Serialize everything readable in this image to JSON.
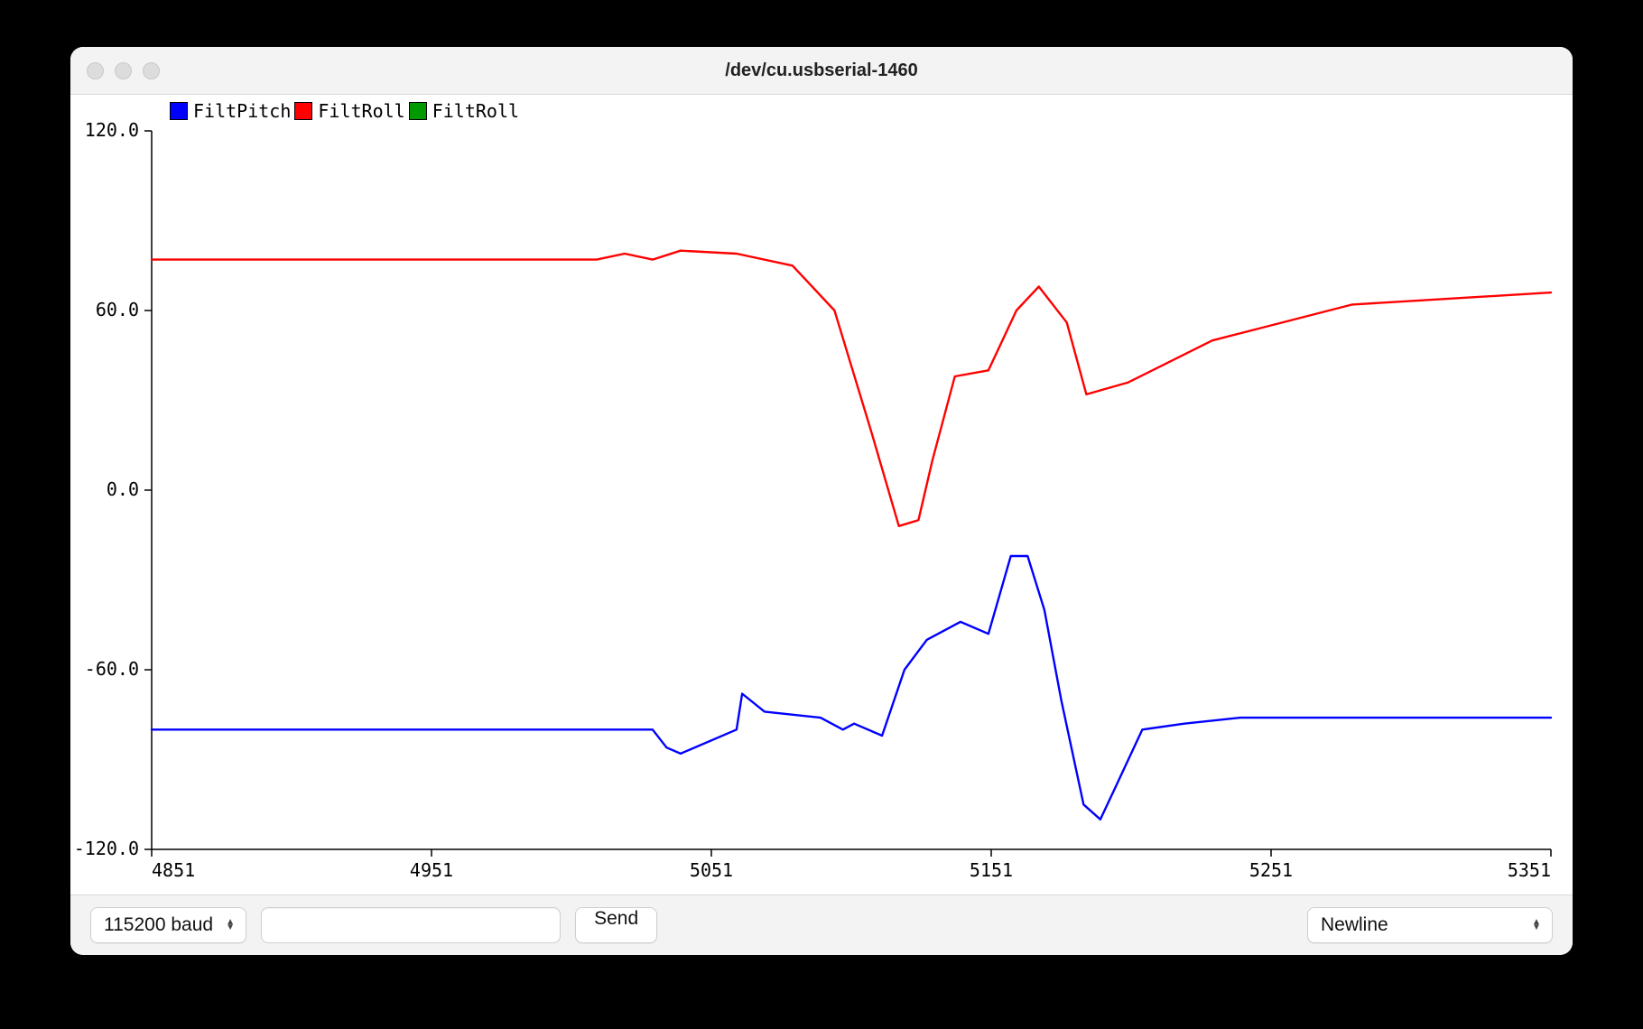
{
  "window": {
    "title": "/dev/cu.usbserial-1460"
  },
  "toolbar": {
    "baud_label": "115200 baud",
    "send_label": "Send",
    "line_ending_label": "Newline",
    "input_value": ""
  },
  "legend": {
    "items": [
      {
        "name": "FiltPitch",
        "color": "#0000ff"
      },
      {
        "name": "FiltRoll",
        "color": "#ff0000"
      },
      {
        "name": "FiltRoll",
        "color": "#009900"
      }
    ]
  },
  "chart_data": {
    "type": "line",
    "xlabel": "",
    "ylabel": "",
    "xlim": [
      4851,
      5351
    ],
    "ylim": [
      -120,
      120
    ],
    "x_ticks": [
      4851,
      4951,
      5051,
      5151,
      5251,
      5351
    ],
    "y_ticks": [
      -120,
      -60,
      0,
      60,
      120
    ],
    "series": [
      {
        "name": "FiltPitch",
        "color": "#0000ff",
        "x": [
          4851,
          4900,
          4950,
          5000,
          5030,
          5035,
          5040,
          5060,
          5062,
          5070,
          5090,
          5098,
          5102,
          5112,
          5120,
          5128,
          5140,
          5150,
          5158,
          5164,
          5170,
          5176,
          5184,
          5190,
          5195,
          5205,
          5220,
          5240,
          5280,
          5351
        ],
        "values": [
          -80,
          -80,
          -80,
          -80,
          -80,
          -86,
          -88,
          -80,
          -68,
          -74,
          -76,
          -80,
          -78,
          -82,
          -60,
          -50,
          -44,
          -48,
          -22,
          -22,
          -40,
          -70,
          -105,
          -110,
          -100,
          -80,
          -78,
          -76,
          -76,
          -76
        ]
      },
      {
        "name": "FiltRoll",
        "color": "#ff0000",
        "x": [
          4851,
          4950,
          5010,
          5020,
          5030,
          5040,
          5060,
          5080,
          5095,
          5108,
          5118,
          5125,
          5130,
          5138,
          5150,
          5160,
          5168,
          5178,
          5185,
          5200,
          5230,
          5280,
          5351
        ],
        "values": [
          77,
          77,
          77,
          79,
          77,
          80,
          79,
          75,
          60,
          20,
          -12,
          -10,
          10,
          38,
          40,
          60,
          68,
          56,
          32,
          36,
          50,
          62,
          66
        ]
      },
      {
        "name": "FiltRoll",
        "color": "#009900",
        "x": [],
        "values": []
      }
    ]
  }
}
